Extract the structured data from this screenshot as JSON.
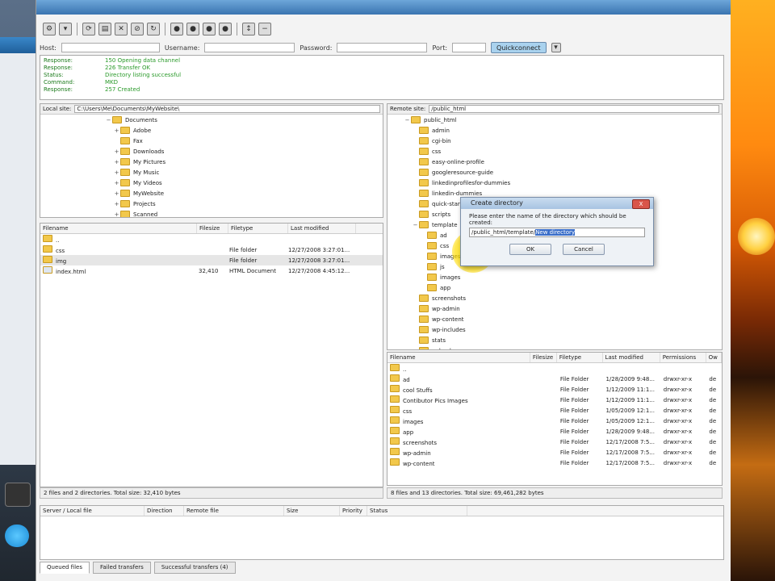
{
  "toolbar": {
    "buttons": [
      "site-manager",
      "connect",
      "refresh",
      "process-queue",
      "cancel",
      "disconnect",
      "reconnect",
      "view-filters",
      "compare",
      "sync-browsing",
      "search"
    ]
  },
  "quickconnect": {
    "host_label": "Host:",
    "username_label": "Username:",
    "password_label": "Password:",
    "port_label": "Port:",
    "button_label": "Quickconnect"
  },
  "message_log": [
    {
      "key": "Response:",
      "value": "150 Opening data channel"
    },
    {
      "key": "Response:",
      "value": "226 Transfer OK"
    },
    {
      "key": "Status:",
      "value": "Directory listing successful"
    },
    {
      "key": "Command:",
      "value": "MKD"
    },
    {
      "key": "Response:",
      "value": "257 Created"
    }
  ],
  "local": {
    "site_label": "Local site:",
    "path": "C:\\Users\\Me\\Documents\\MyWebsite\\",
    "tree": [
      {
        "name": "Documents",
        "indent": 2,
        "exp": "−"
      },
      {
        "name": "Adobe",
        "indent": 3,
        "exp": "+"
      },
      {
        "name": "Fax",
        "indent": 3,
        "exp": ""
      },
      {
        "name": "Downloads",
        "indent": 3,
        "exp": "+"
      },
      {
        "name": "My Pictures",
        "indent": 3,
        "exp": "+"
      },
      {
        "name": "My Music",
        "indent": 3,
        "exp": "+"
      },
      {
        "name": "My Videos",
        "indent": 3,
        "exp": "+"
      },
      {
        "name": "MyWebsite",
        "indent": 3,
        "exp": "+"
      },
      {
        "name": "Projects",
        "indent": 3,
        "exp": "+"
      },
      {
        "name": "Scanned",
        "indent": 3,
        "exp": "+"
      }
    ],
    "columns": [
      "Filename",
      "Filesize",
      "Filetype",
      "Last modified"
    ],
    "files": [
      {
        "name": "..",
        "size": "",
        "type": "",
        "modified": "",
        "kind": "folder"
      },
      {
        "name": "css",
        "size": "",
        "type": "File folder",
        "modified": "12/27/2008 3:27:01...",
        "kind": "folder"
      },
      {
        "name": "img",
        "size": "",
        "type": "File folder",
        "modified": "12/27/2008 3:27:01...",
        "kind": "folder",
        "selected": true
      },
      {
        "name": "index.html",
        "size": "32,410",
        "type": "HTML Document",
        "modified": "12/27/2008 4:45:12...",
        "kind": "file"
      }
    ],
    "status": "2 files and 2 directories. Total size: 32,410 bytes"
  },
  "remote": {
    "site_label": "Remote site:",
    "path": "/public_html",
    "tree": [
      {
        "name": "public_html",
        "indent": 1,
        "exp": "−"
      },
      {
        "name": "admin",
        "indent": 2,
        "exp": ""
      },
      {
        "name": "cgi-bin",
        "indent": 2,
        "exp": ""
      },
      {
        "name": "css",
        "indent": 2,
        "exp": ""
      },
      {
        "name": "easy-online-profile",
        "indent": 2,
        "exp": ""
      },
      {
        "name": "googleresource-guide",
        "indent": 2,
        "exp": ""
      },
      {
        "name": "linkedinprofilesfor-dummies",
        "indent": 2,
        "exp": ""
      },
      {
        "name": "linkedin-dummies",
        "indent": 2,
        "exp": ""
      },
      {
        "name": "quick-start",
        "indent": 2,
        "exp": ""
      },
      {
        "name": "scripts",
        "indent": 2,
        "exp": ""
      },
      {
        "name": "template",
        "indent": 2,
        "exp": "−"
      },
      {
        "name": "ad",
        "indent": 3,
        "exp": ""
      },
      {
        "name": "css",
        "indent": 3,
        "exp": ""
      },
      {
        "name": "images",
        "indent": 3,
        "exp": ""
      },
      {
        "name": "js",
        "indent": 3,
        "exp": ""
      },
      {
        "name": "images",
        "indent": 3,
        "exp": ""
      },
      {
        "name": "app",
        "indent": 3,
        "exp": ""
      },
      {
        "name": "screenshots",
        "indent": 2,
        "exp": ""
      },
      {
        "name": "wp-admin",
        "indent": 2,
        "exp": ""
      },
      {
        "name": "wp-content",
        "indent": 2,
        "exp": ""
      },
      {
        "name": "wp-includes",
        "indent": 2,
        "exp": ""
      },
      {
        "name": "stats",
        "indent": 2,
        "exp": ""
      },
      {
        "name": "uploads",
        "indent": 2,
        "exp": ""
      }
    ],
    "columns": [
      "Filename",
      "Filesize",
      "Filetype",
      "Last modified",
      "Permissions",
      "Ow"
    ],
    "files": [
      {
        "name": "..",
        "size": "",
        "type": "",
        "modified": "",
        "perms": "",
        "owner": ""
      },
      {
        "name": "ad",
        "size": "",
        "type": "File Folder",
        "modified": "1/28/2009 9:48...",
        "perms": "drwxr-xr-x",
        "owner": "de"
      },
      {
        "name": "cool Stuffs",
        "size": "",
        "type": "File Folder",
        "modified": "1/12/2009 11:1...",
        "perms": "drwxr-xr-x",
        "owner": "de"
      },
      {
        "name": "Contibutor Pics Images",
        "size": "",
        "type": "File Folder",
        "modified": "1/12/2009 11:1...",
        "perms": "drwxr-xr-x",
        "owner": "de"
      },
      {
        "name": "css",
        "size": "",
        "type": "File Folder",
        "modified": "1/05/2009 12:1...",
        "perms": "drwxr-xr-x",
        "owner": "de"
      },
      {
        "name": "images",
        "size": "",
        "type": "File Folder",
        "modified": "1/05/2009 12:1...",
        "perms": "drwxr-xr-x",
        "owner": "de"
      },
      {
        "name": "app",
        "size": "",
        "type": "File Folder",
        "modified": "1/28/2009 9:48...",
        "perms": "drwxr-xr-x",
        "owner": "de"
      },
      {
        "name": "screenshots",
        "size": "",
        "type": "File Folder",
        "modified": "12/17/2008 7:5...",
        "perms": "drwxr-xr-x",
        "owner": "de"
      },
      {
        "name": "wp-admin",
        "size": "",
        "type": "File Folder",
        "modified": "12/17/2008 7:5...",
        "perms": "drwxr-xr-x",
        "owner": "de"
      },
      {
        "name": "wp-content",
        "size": "",
        "type": "File Folder",
        "modified": "12/17/2008 7:5...",
        "perms": "drwxr-xr-x",
        "owner": "de"
      }
    ],
    "status": "8 files and 13 directories. Total size: 69,461,282 bytes"
  },
  "dialog": {
    "title": "Create directory",
    "close": "X",
    "message": "Please enter the name of the directory which should be created:",
    "value_prefix": "/public_html/template/",
    "value_selected": "New directory",
    "ok": "OK",
    "cancel": "Cancel"
  },
  "queue": {
    "columns": [
      "Server / Local file",
      "Direction",
      "Remote file",
      "Size",
      "Priority",
      "Status"
    ]
  },
  "bottom_tabs": [
    "Queued files",
    "Failed transfers",
    "Successful transfers (4)"
  ],
  "colors": {
    "folder": "#f2c84b",
    "highlight": "#ffe600",
    "selection": "#3a6ec9"
  }
}
